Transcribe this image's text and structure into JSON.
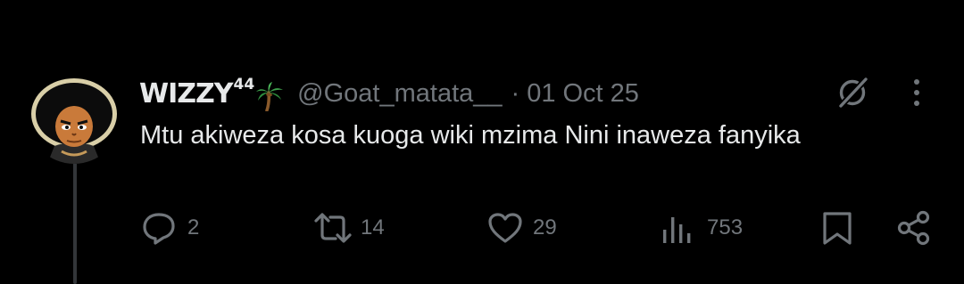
{
  "tweet": {
    "display_name": "WIZZY",
    "name_suffix": "44",
    "name_emoji_icon": "palm-tree-icon",
    "handle": "@Goat_matata__",
    "separator": "·",
    "date": "01 Oct 25",
    "text": "Mtu akiweza kosa kuoga wiki mzima Nini inaweza fanyika"
  },
  "actions": {
    "replies": "2",
    "reposts": "14",
    "likes": "29",
    "views": "753"
  },
  "icons": {
    "header_right": [
      "grok-icon",
      "more-vertical-icon"
    ],
    "action_bar": [
      "reply-icon",
      "repost-icon",
      "like-icon",
      "views-icon",
      "bookmark-icon",
      "share-icon"
    ]
  },
  "colors": {
    "background": "#000000",
    "text_primary": "#e7e9ea",
    "text_secondary": "#71767b",
    "thread_line": "#333639"
  }
}
